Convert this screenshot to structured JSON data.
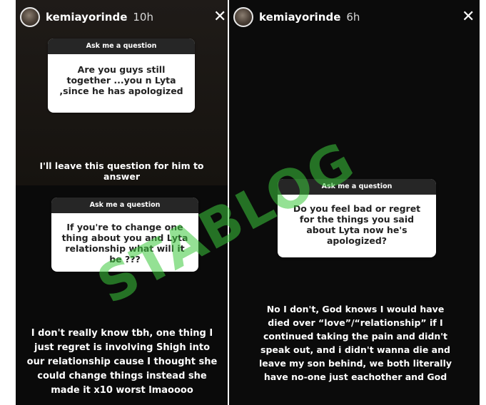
{
  "left_top": {
    "username": "kemiayorinde",
    "time": "10h",
    "close_glyph": "✕",
    "card": {
      "header": "Ask me a question",
      "question": "Are you guys still together ...you n Lyta ,since he has apologized"
    },
    "answer": "I'll leave this question for him to answer"
  },
  "left_bottom": {
    "card": {
      "header": "Ask me a question",
      "question": "If you're to change one thing about you and Lyta relationship what will it be ???"
    },
    "answer": "I don't really know tbh, one thing I just regret is involving Shigh into our relationship cause I thought she could change things instead she made it x10 worst lmaoooo"
  },
  "right": {
    "username": "kemiayorinde",
    "time": "6h",
    "close_glyph": "✕",
    "card": {
      "header": "Ask me a question",
      "question": "Do you feel bad or regret for the things you said about Lyta now he's apologized?"
    },
    "answer": "No I don't, God knows I would have died over “love”/“relationship” if I continued taking the pain and didn't speak out, and i didn't wanna die and leave my son behind, we both literally have no-one just eachother and God"
  },
  "watermark": "STABLOG"
}
